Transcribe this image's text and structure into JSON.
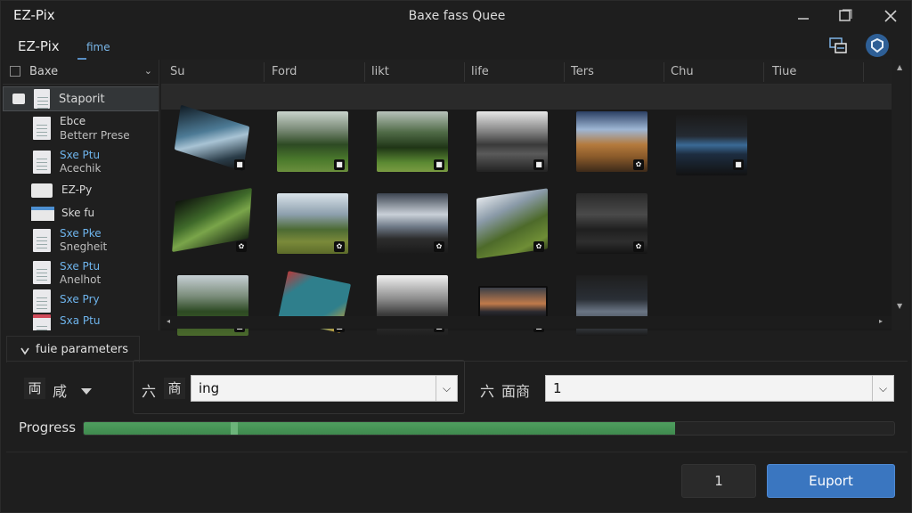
{
  "titlebar": {
    "app_title": "EZ-Pix",
    "window_title": "Baxe fass Quee",
    "controls": [
      "minimize-icon",
      "maximize-icon",
      "close-icon"
    ]
  },
  "menubar": {
    "app_label": "EZ-Pix",
    "tab_label": "fime",
    "icons": [
      "image-transfer-icon",
      "shield-badge-icon"
    ]
  },
  "sidebar": {
    "header_label": "Baxe",
    "items": [
      {
        "line1": "Staporit",
        "line2": "",
        "icon": "folder-icon",
        "selected": true
      },
      {
        "line1": "Ebce",
        "line2": "Betterr Prese",
        "icon": "document-icon"
      },
      {
        "line1": "Sxe Ptu",
        "line2": "Acechik",
        "icon": "document-icon"
      },
      {
        "line1": "EZ-Py",
        "line2": "",
        "icon": "folder-icon"
      },
      {
        "line1": "Ske fu",
        "line2": "",
        "icon": "window-icon"
      },
      {
        "line1": "Sxe Pke",
        "line2": "Snegheit",
        "icon": "document-icon"
      },
      {
        "line1": "Sxe Ptu",
        "line2": "Anelhot",
        "icon": "document-icon"
      },
      {
        "line1": "Sxe Pry",
        "line2": "",
        "icon": "document-icon"
      },
      {
        "line1": "Sxa Ptu",
        "line2": "",
        "icon": "document-icon"
      }
    ]
  },
  "grid": {
    "columns": [
      "Su",
      "Ford",
      "likt",
      "life",
      "Ters",
      "Chu",
      "Tiue"
    ],
    "thumbnails": [
      "Tilted landscape photo",
      "Forest meadow",
      "Dark forest path",
      "Cloud road",
      "Sunset field road",
      "Lake horizon",
      "Tilted grass field",
      "Green hills",
      "Sunburst road",
      "Tilted tree field",
      "Dark lake",
      "Forest glade",
      "Teal sticker image",
      "Cloud rays",
      "Dusk horizon",
      "Dark spire"
    ]
  },
  "params": {
    "section_label": "fuie parameters",
    "left_glyphs": [
      "両",
      "咸"
    ],
    "group_glyphs": [
      "六",
      "商"
    ],
    "format_select": "ing",
    "quality_glyphs": [
      "六",
      "面商"
    ],
    "quality_select": "1"
  },
  "progress": {
    "label": "Progress",
    "value": 0.73
  },
  "footer": {
    "count_button": "1",
    "export_button": "Euport"
  },
  "colors": {
    "accent": "#3a76c0",
    "progress": "#4f9e5f",
    "link": "#6eb4ec"
  }
}
